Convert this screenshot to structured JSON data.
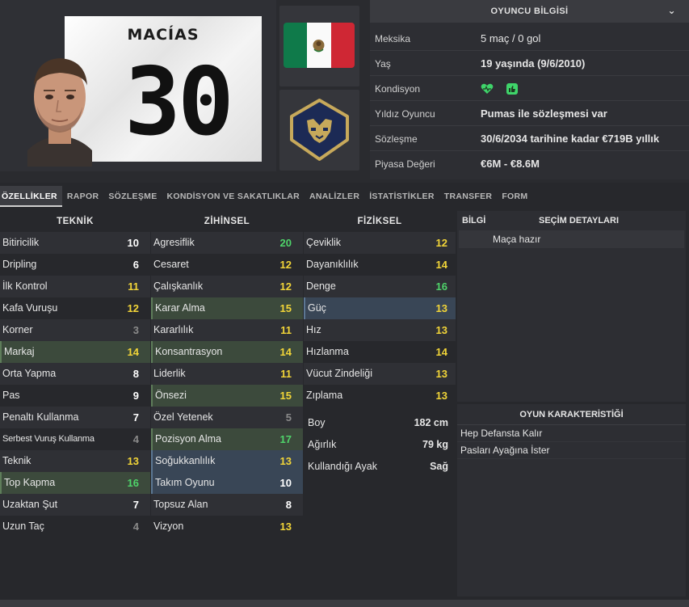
{
  "player": {
    "shirt_name": "MACÍAS",
    "shirt_number": "30"
  },
  "info_panel": {
    "title": "OYUNCU BİLGİSİ",
    "rows": [
      {
        "label": "Meksika",
        "value": "5 maç / 0 gol"
      },
      {
        "label": "Yaş",
        "value": "19 yaşında (9/6/2010)"
      },
      {
        "label": "Kondisyon",
        "value": ""
      },
      {
        "label": "Yıldız Oyuncu",
        "value": "Pumas ile sözleşmesi var"
      },
      {
        "label": "Sözleşme",
        "value": "30/6/2034 tarihine kadar €719B yıllık"
      },
      {
        "label": "Piyasa Değeri",
        "value": "€6M - €8.6M"
      }
    ]
  },
  "tabs": [
    "ÖZELLİKLER",
    "RAPOR",
    "SÖZLEŞME",
    "KONDİSYON VE SAKATLIKLAR",
    "ANALİZLER",
    "İSTATİSTİKLER",
    "TRANSFER",
    "FORM"
  ],
  "attributes": {
    "technical_title": "TEKNİK",
    "mental_title": "ZİHİNSEL",
    "physical_title": "FİZİKSEL",
    "technical": [
      {
        "name": "Bitiricilik",
        "value": "10"
      },
      {
        "name": "Dripling",
        "value": "6"
      },
      {
        "name": "İlk Kontrol",
        "value": "11"
      },
      {
        "name": "Kafa Vuruşu",
        "value": "12"
      },
      {
        "name": "Korner",
        "value": "3"
      },
      {
        "name": "Markaj",
        "value": "14"
      },
      {
        "name": "Orta Yapma",
        "value": "8"
      },
      {
        "name": "Pas",
        "value": "9"
      },
      {
        "name": "Penaltı Kullanma",
        "value": "7"
      },
      {
        "name": "Serbest Vuruş Kullanma",
        "value": "4"
      },
      {
        "name": "Teknik",
        "value": "13"
      },
      {
        "name": "Top Kapma",
        "value": "16"
      },
      {
        "name": "Uzaktan Şut",
        "value": "7"
      },
      {
        "name": "Uzun Taç",
        "value": "4"
      }
    ],
    "mental": [
      {
        "name": "Agresiflik",
        "value": "20"
      },
      {
        "name": "Cesaret",
        "value": "12"
      },
      {
        "name": "Çalışkanlık",
        "value": "12"
      },
      {
        "name": "Karar Alma",
        "value": "15"
      },
      {
        "name": "Kararlılık",
        "value": "11"
      },
      {
        "name": "Konsantrasyon",
        "value": "14"
      },
      {
        "name": "Liderlik",
        "value": "11"
      },
      {
        "name": "Önsezi",
        "value": "15"
      },
      {
        "name": "Özel Yetenek",
        "value": "5"
      },
      {
        "name": "Pozisyon Alma",
        "value": "17"
      },
      {
        "name": "Soğukkanlılık",
        "value": "13"
      },
      {
        "name": "Takım Oyunu",
        "value": "10"
      },
      {
        "name": "Topsuz Alan",
        "value": "8"
      },
      {
        "name": "Vizyon",
        "value": "13"
      }
    ],
    "physical": [
      {
        "name": "Çeviklik",
        "value": "12"
      },
      {
        "name": "Dayanıklılık",
        "value": "14"
      },
      {
        "name": "Denge",
        "value": "16"
      },
      {
        "name": "Güç",
        "value": "13"
      },
      {
        "name": "Hız",
        "value": "13"
      },
      {
        "name": "Hızlanma",
        "value": "14"
      },
      {
        "name": "Vücut Zindeliği",
        "value": "13"
      },
      {
        "name": "Zıplama",
        "value": "13"
      }
    ],
    "physical_extra": [
      {
        "name": "Boy",
        "value": "182 cm"
      },
      {
        "name": "Ağırlık",
        "value": "79 kg"
      },
      {
        "name": "Kullandığı Ayak",
        "value": "Sağ"
      }
    ]
  },
  "selection_panel": {
    "col_a": "BİLGİ",
    "col_b": "SEÇİM DETAYLARI",
    "row": "Maça hazır"
  },
  "traits_panel": {
    "title": "OYUN KARAKTERİSTİĞİ",
    "items": [
      "Hep Defansta Kalır",
      "Pasları Ayağına İster"
    ]
  },
  "colors": {
    "value_white": "#ffffff",
    "value_grey": "#8a8a8a",
    "value_yellow": "#f2d538",
    "value_green": "#4fd46a",
    "highlight_green": "#3c4a3c",
    "highlight_blue": "#394656"
  }
}
